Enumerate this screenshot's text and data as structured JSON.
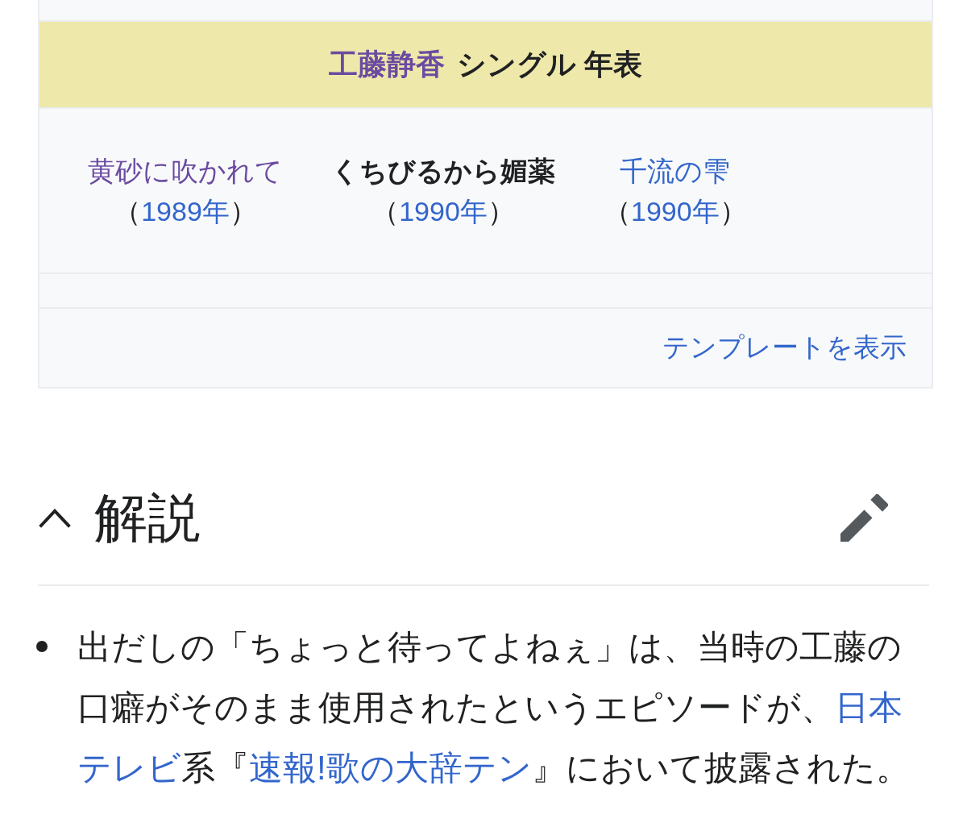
{
  "navbox": {
    "title": {
      "link": "工藤静香",
      "visited": true,
      "text": "シングル 年表"
    },
    "items": [
      {
        "kind": "visited",
        "title": "黄砂に吹かれて",
        "year": {
          "open": "（",
          "link": "1989年",
          "close": "）"
        }
      },
      {
        "kind": "current",
        "title": "くちびるから媚薬",
        "year": {
          "open": "（",
          "link": "1990年",
          "close": "）"
        }
      },
      {
        "kind": "link",
        "title": "千流の雫",
        "year": {
          "open": "（",
          "link": "1990年",
          "close": "）"
        }
      }
    ],
    "view_template_link": "テンプレートを表示"
  },
  "section": {
    "title": "解説",
    "expanded": true
  },
  "bullets": [
    {
      "runs": [
        {
          "kind": "text",
          "text": "出だしの「ちょっと待ってよねぇ」は、当時の工藤の口癖がそのまま使用されたというエピソードが、"
        },
        {
          "kind": "link",
          "text": "日本"
        },
        {
          "kind": "link",
          "text": "テレビ"
        },
        {
          "kind": "text",
          "text": "系『"
        },
        {
          "kind": "link",
          "text": "速報!歌の大辞テン"
        },
        {
          "kind": "text",
          "text": "』において披露された。"
        }
      ]
    }
  ]
}
